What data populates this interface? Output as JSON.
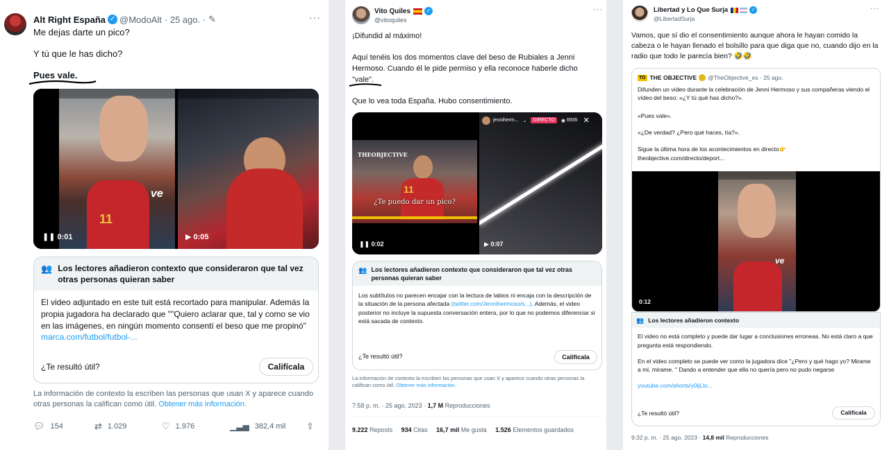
{
  "tweet1": {
    "name": "Alt Right España",
    "handle": "@ModoAlt",
    "date": "· 25 ago. ·",
    "line1": "Me dejas darte un pico?",
    "line2": "Y tú que le has dicho?",
    "line3": "Pues vale.",
    "video_time_1": "0:01",
    "video_time_2": "0:05",
    "note_title": "Los lectores añadieron contexto que consideraron que tal vez otras personas quieran saber",
    "note_body": "El video adjuntado en este tuit está recortado para manipular. Además la propia jugadora ha declarado que \"\"Quiero aclarar que, tal y como se vio en las imágenes, en ningún momento consentí el beso que me propinó\"",
    "note_link": "marca.com/futbol/futbol-...",
    "useful": "¿Te resultó útil?",
    "rate": "Califícala",
    "disclaimer": "La información de contexto la escriben las personas que usan X y aparece cuando otras personas la califican como útil.",
    "more_info": "Obtener más información.",
    "replies": "154",
    "reposts": "1.029",
    "likes": "1.976",
    "views": "382,4 mil"
  },
  "tweet2": {
    "name": "Vito Quiles",
    "handle": "@vitoquiles",
    "line1": "¡Difundid al máximo!",
    "line2": "Aquí tenéis los dos momentos clave del beso de Rubiales a Jenni Hermoso. Cuando él le pide permiso y ella reconoce haberle dicho",
    "line2b": "\"vale\".",
    "line3": "Que lo vea toda España. Hubo consentimiento.",
    "video_caption": "¿Te puedo dar un pico?",
    "video_brand": "THEOBJECTIVE",
    "ig_user": "jenniherm...",
    "ig_live": "DIRECTO",
    "ig_viewers": "6935",
    "video_time_1": "0:02",
    "video_time_2": "0:07",
    "note_title": "Los lectores añadieron contexto que consideraron que tal vez otras personas quieran saber",
    "note_body": "Los subtítulos no parecen encajar con la lectura de labios ni encaja con la descripción de la situación de la persona afectada",
    "note_link": "(twitter.com/Jennihermoso/s...)",
    "note_body2": ". Además, el video posterior no incluye la supuesta conversación entera, por lo que no podemos diferenciar si está sacada de contexto.",
    "useful": "¿Te resultó útil?",
    "rate": "Califícala",
    "disclaimer": "La información de contexto la escriben las personas que usan X y aparece cuando otras personas la califican como útil.",
    "more_info": "Obtener más información.",
    "timestamp": "7:58 p. m. · 25 ago. 2023 ·",
    "views_num": "1,7 M",
    "views_label": "Reproducciones",
    "reposts_num": "9.222",
    "reposts_label": "Reposts",
    "quotes_num": "934",
    "quotes_label": "Citas",
    "likes_num": "16,7 mil",
    "likes_label": "Me gusta",
    "saves_num": "1.526",
    "saves_label": "Elementos guardados"
  },
  "tweet3": {
    "name": "Libertad y Lo Que Surja",
    "handle": "@LibertadSurja",
    "text": "Vamos, que sí dio el consentimiento aunque ahora le hayan comido la cabeza o le hayan llenado el bolsillo para que diga que no, cuando dijo en la radio que todo le parecía bien? 🤣🤣",
    "quote_badge": "TO",
    "quote_name": "THE OBJECTIVE",
    "quote_handle": "@TheObjective_es · 25 ago.",
    "quote_l1": "Difunden un vídeo durante la celebración de Jenni Hermoso y sus compañeras viendo el vídeo del beso: «¿Y tú qué has dicho?».",
    "quote_l2": "«Pues vale».",
    "quote_l3": "«¿De verdad? ¿Pero qué haces, tía?».",
    "quote_l4": "Sigue la última hora de los acontecimientos en directo👉",
    "quote_link": "theobjective.com/directo/deport...",
    "video_time": "0:12",
    "note_title": "Los lectores añadieron contexto",
    "note_body": "El video no está completo y puede dar lugar a conclusiones erroneas. No está claro a que pregunta está respondiendo.",
    "note_body2": "En el video completo se puede ver como la jugadora dice \"¿Pero y qué hago yo? Mirame a mi, mirame. \" Dando a entender que ella no quería pero no pudo negarse",
    "note_link": "youtube.com/shorts/y0ljLlo...",
    "useful": "¿Te resultó útil?",
    "rate": "Califícala",
    "timestamp": "9:32 p. m. · 25 ago. 2023 ·",
    "views_num": "14,8 mil",
    "views_label": "Reproducciones"
  },
  "colors": {
    "link": "#1d9bf0",
    "verified": "#1d9bf0",
    "live": "#e5355f"
  }
}
